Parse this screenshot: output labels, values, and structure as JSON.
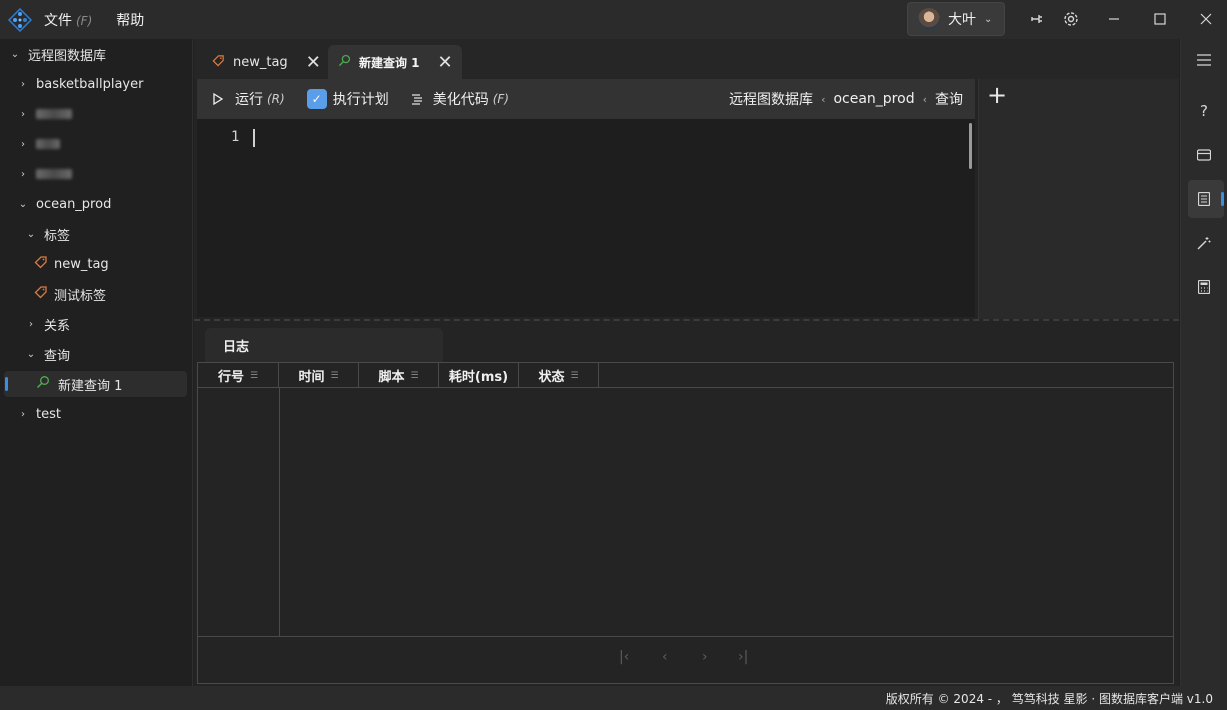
{
  "menu": {
    "file_label": "文件",
    "file_hotkey": "(F)",
    "help_label": "帮助"
  },
  "user": {
    "name": "大叶"
  },
  "sidebar": {
    "root": "远程图数据库",
    "items": [
      {
        "label": "basketballplayer"
      },
      {
        "label": "ocean_prod"
      },
      {
        "label": "标签"
      },
      {
        "label": "new_tag"
      },
      {
        "label": "测试标签"
      },
      {
        "label": "关系"
      },
      {
        "label": "查询"
      },
      {
        "label": "新建查询 1"
      },
      {
        "label": "test"
      }
    ]
  },
  "tabs": [
    {
      "label": "new_tag"
    },
    {
      "label": "新建查询 1"
    }
  ],
  "toolbar": {
    "run_label": "运行",
    "run_hotkey": "(R)",
    "plan_label": "执行计划",
    "beautify_label": "美化代码",
    "beautify_hotkey": "(F)"
  },
  "breadcrumb": [
    "远程图数据库",
    "ocean_prod",
    "查询"
  ],
  "editor": {
    "line_number": "1"
  },
  "log": {
    "tab_label": "日志",
    "columns": [
      "行号",
      "时间",
      "脚本",
      "耗时(ms)",
      "状态"
    ]
  },
  "statusbar": {
    "text": "版权所有 © 2024 - ， 笃笃科技  星影 · 图数据库客户端  v1.0"
  },
  "colors": {
    "accent": "#3a8ee6",
    "tag": "#e07a3c",
    "query": "#4caf50"
  }
}
